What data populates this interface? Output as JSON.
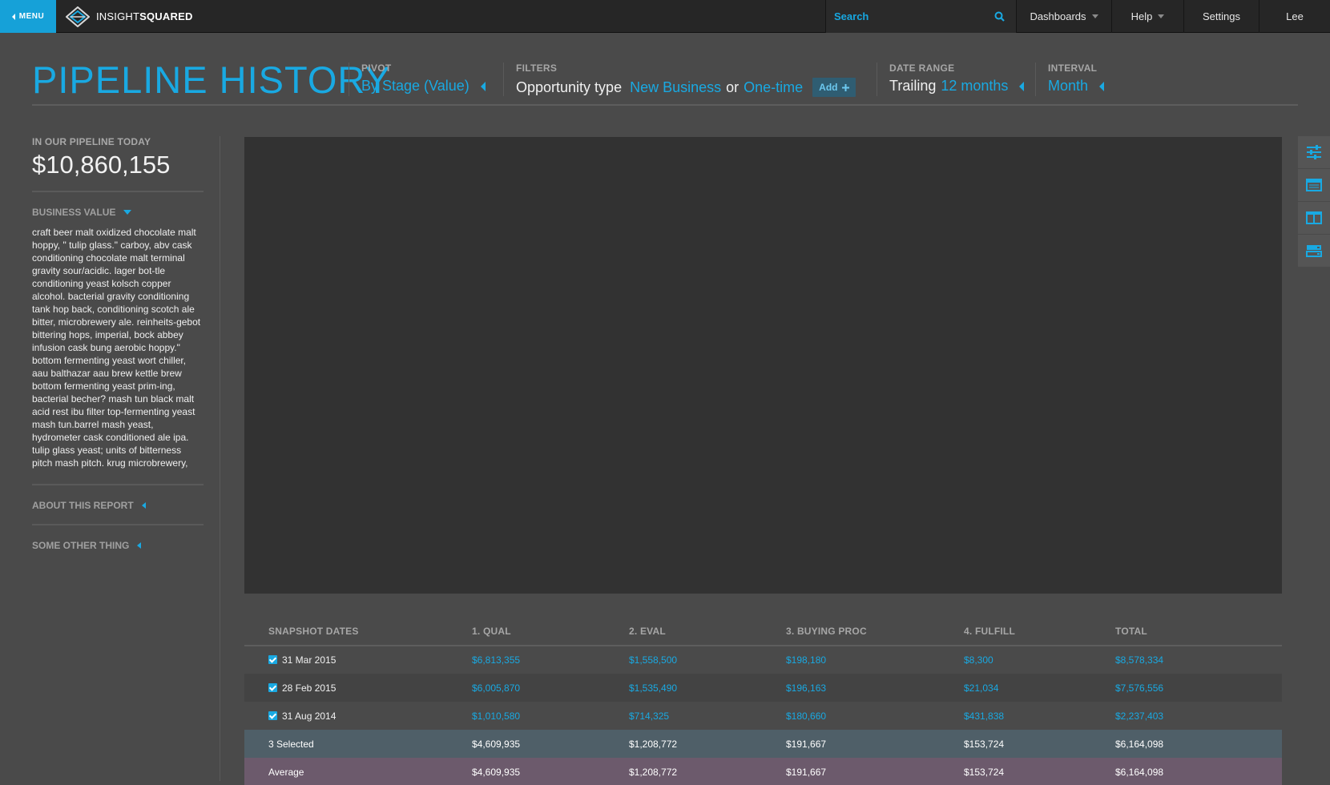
{
  "nav": {
    "menu_label": "MENU",
    "logo_light": "INSIGHT",
    "logo_bold": "SQUARED",
    "search_placeholder": "Search",
    "dashboards": "Dashboards",
    "help": "Help",
    "settings": "Settings",
    "user": "Lee"
  },
  "header": {
    "title": "PIPELINE HISTORY",
    "pivot_label": "PIVOT",
    "pivot_value": "By Stage (Value)",
    "filters_label": "FILTERS",
    "filter_field": "Opportunity type",
    "filter_value_1": "New Business",
    "filter_or": "or",
    "filter_value_2": "One-time",
    "add_label": "Add",
    "date_range_label": "DATE RANGE",
    "date_range_prefix": "Trailing",
    "date_range_value": "12 months",
    "interval_label": "INTERVAL",
    "interval_value": "Month"
  },
  "sidebar": {
    "kpi_label": "IN OUR PIPELINE TODAY",
    "kpi_value": "$10,860,155",
    "business_value_label": "BUSINESS VALUE",
    "business_value_text": "craft beer malt oxidized chocolate malt hoppy, \" tulip glass.\" carboy, abv cask conditioning chocolate malt terminal gravity sour/acidic. lager bot-tle conditioning yeast kolsch copper alcohol. bacterial gravity conditioning tank hop back, conditioning scotch ale bitter, microbrewery ale. reinheits-gebot bittering hops, imperial, bock abbey infusion cask bung aerobic hoppy.\" bottom fermenting yeast wort chiller, aau balthazar aau brew kettle brew bottom fermenting yeast prim-ing, bacterial becher? mash tun black malt acid rest ibu filter top-fermenting yeast mash tun.barrel mash yeast, hydrometer cask conditioned ale ipa. tulip glass yeast; units of bitterness pitch mash pitch. krug microbrewery,",
    "about_label": "ABOUT THIS REPORT",
    "other_label": "SOME OTHER THING"
  },
  "tools": [
    "sliders-icon",
    "table-icon",
    "columns-icon",
    "rows-icon"
  ],
  "table": {
    "headers": [
      "SNAPSHOT DATES",
      "1. QUAL",
      "2. EVAL",
      "3. BUYING PROC",
      "4. FULFILL",
      "TOTAL"
    ],
    "rows": [
      {
        "date": "31 Mar 2015",
        "checked": true,
        "values": [
          "$6,813,355",
          "$1,558,500",
          "$198,180",
          "$8,300",
          "$8,578,334"
        ]
      },
      {
        "date": "28 Feb 2015",
        "checked": true,
        "values": [
          "$6,005,870",
          "$1,535,490",
          "$196,163",
          "$21,034",
          "$7,576,556"
        ]
      },
      {
        "date": "31 Aug 2014",
        "checked": true,
        "values": [
          "$1,010,580",
          "$714,325",
          "$180,660",
          "$431,838",
          "$2,237,403"
        ]
      }
    ],
    "selected": {
      "label": "3 Selected",
      "values": [
        "$4,609,935",
        "$1,208,772",
        "$191,667",
        "$153,724",
        "$6,164,098"
      ]
    },
    "average": {
      "label": "Average",
      "values": [
        "$4,609,935",
        "$1,208,772",
        "$191,667",
        "$153,724",
        "$6,164,098"
      ]
    }
  },
  "colors": {
    "accent": "#19a9e2",
    "background": "#4a4a4a",
    "topbar": "#262626",
    "selected_row": "#4f5f68",
    "average_row": "#6c5a6c"
  }
}
